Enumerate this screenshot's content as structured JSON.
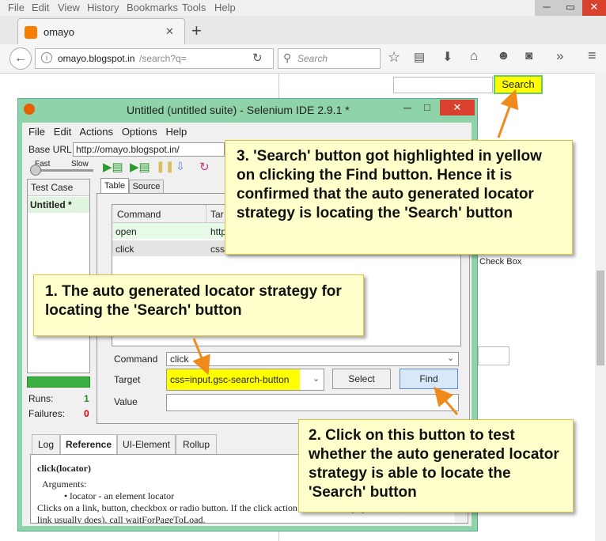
{
  "browser": {
    "menu": [
      "File",
      "Edit",
      "View",
      "History",
      "Bookmarks",
      "Tools",
      "Help"
    ],
    "tab_title": "omayo",
    "close_tab_glyph": "✕",
    "new_tab_glyph": "+",
    "url_host": "omayo.blogspot.in",
    "url_path": "/search?q=",
    "search_placeholder": "Search"
  },
  "page": {
    "search_button": "Search",
    "checkbox_label": "Check Box"
  },
  "ide": {
    "title": "Untitled (untitled suite) - Selenium IDE 2.9.1 *",
    "menu": [
      "File",
      "Edit",
      "Actions",
      "Options",
      "Help"
    ],
    "base_url_label": "Base URL",
    "base_url": "http://omayo.blogspot.in/",
    "speed_fast": "Fast",
    "speed_slow": "Slow",
    "test_case_header": "Test Case",
    "test_case_name": "Untitled *",
    "tabs": [
      "Table",
      "Source"
    ],
    "col_command": "Command",
    "col_target": "Tar",
    "rows": [
      {
        "command": "open",
        "target": "http"
      },
      {
        "command": "click",
        "target": "css="
      }
    ],
    "command_label": "Command",
    "command_value": "click",
    "target_label": "Target",
    "target_value": "css=input.gsc-search-button",
    "select_button": "Select",
    "find_button": "Find",
    "value_label": "Value",
    "runs_label": "Runs:",
    "runs_value": "1",
    "failures_label": "Failures:",
    "failures_value": "0",
    "bottom_tabs": [
      "Log",
      "Reference",
      "UI-Element",
      "Rollup"
    ],
    "ref_title": "click(locator)",
    "ref_args": "Arguments:",
    "ref_bullet": "locator - an element locator",
    "ref_desc": "Clicks on a link, button, checkbox or radio button. If the click action causes a new page to load (like a",
    "ref_desc2": "link usually does), call waitForPageToLoad."
  },
  "callouts": {
    "c1": "1. The auto generated locator strategy for locating the 'Search' button",
    "c2": "2. Click on this button to test whether the auto generated locator strategy is able to locate the 'Search' button",
    "c3": "3. 'Search' button got highlighted in yellow on clicking the Find button. Hence it is confirmed that the auto generated locator strategy is locating the 'Search' button"
  },
  "colors": {
    "highlight": "#ffff00",
    "callout_bg": "#ffffcc",
    "arrow": "#f08a1c",
    "ide_frame": "#8fd3a8",
    "close_btn": "#d9412f",
    "runs_green": "#2a8a2a",
    "failures_red": "#cc0000"
  }
}
